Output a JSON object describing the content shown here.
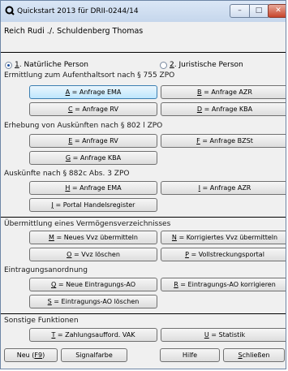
{
  "window": {
    "title": "Quickstart 2013 für DRII-0244/14",
    "subtitle": "Reich Rudi ./. Schuldenberg Thomas",
    "controls": {
      "minimize": "–",
      "maximize": "□",
      "close": "✕"
    }
  },
  "person_type": {
    "natural": {
      "key": "1",
      "label": ". Natürliche Person",
      "selected": true
    },
    "juristic": {
      "key": "2",
      "label": ". Juristische Person",
      "selected": false
    }
  },
  "sections": {
    "aufenthalt": {
      "label": "Ermittlung zum Aufenthaltsort nach § 755 ZPO",
      "buttons": {
        "ema": {
          "key": "A",
          "label": " = Anfrage EMA"
        },
        "azr": {
          "key": "B",
          "label": " = Anfrage AZR"
        },
        "rv": {
          "key": "C",
          "label": " = Anfrage RV"
        },
        "kba": {
          "key": "D",
          "label": " = Anfrage KBA"
        }
      }
    },
    "auskuenfte802": {
      "label": "Erhebung von Auskünften nach § 802 l ZPO",
      "buttons": {
        "rv": {
          "key": "E",
          "label": " = Anfrage RV"
        },
        "bzst": {
          "key": "F",
          "label": " = Anfrage BZSt"
        },
        "kba": {
          "key": "G",
          "label": " = Anfrage KBA"
        }
      }
    },
    "auskuenfte882": {
      "label": "Auskünfte nach § 882c Abs. 3 ZPO",
      "buttons": {
        "ema": {
          "key": "H",
          "label": " = Anfrage EMA"
        },
        "azr": {
          "key": "I",
          "label": " = Anfrage AZR"
        },
        "handelsregister": {
          "key": "J",
          "label": " = Portal Handelsregister"
        }
      }
    },
    "vermoegen": {
      "label": "Übermittlung eines Vermögensverzeichnisses",
      "buttons": {
        "neu": {
          "key": "M",
          "label": " = Neues Vvz übermitteln"
        },
        "korrigiert": {
          "key": "N",
          "label": " = Korrigiertes Vvz übermitteln"
        },
        "loeschen": {
          "key": "O",
          "label": " = Vvz löschen"
        },
        "portal": {
          "key": "P",
          "label": " = Vollstreckungsportal"
        }
      }
    },
    "eintragung": {
      "label": "Eintragungsanordnung",
      "buttons": {
        "neu": {
          "key": "Q",
          "label": " = Neue Eintragungs-AO"
        },
        "korrigieren": {
          "key": "R",
          "label": " = Eintragungs-AO korrigieren"
        },
        "loeschen": {
          "key": "S",
          "label": " = Eintragungs-AO löschen"
        }
      }
    },
    "sonstige": {
      "label": "Sonstige Funktionen",
      "buttons": {
        "vak": {
          "key": "T",
          "label": " = Zahlungsaufford. VAK"
        },
        "statistik": {
          "key": "U",
          "label": " = Statistik"
        }
      }
    }
  },
  "footer": {
    "neu_prefix": "Neu (",
    "neu_key": "F9",
    "neu_suffix": ")",
    "signalfarbe": "Signalfarbe",
    "hilfe": "Hilfe",
    "schliessen_key": "S",
    "schliessen_rest": "chließen"
  }
}
